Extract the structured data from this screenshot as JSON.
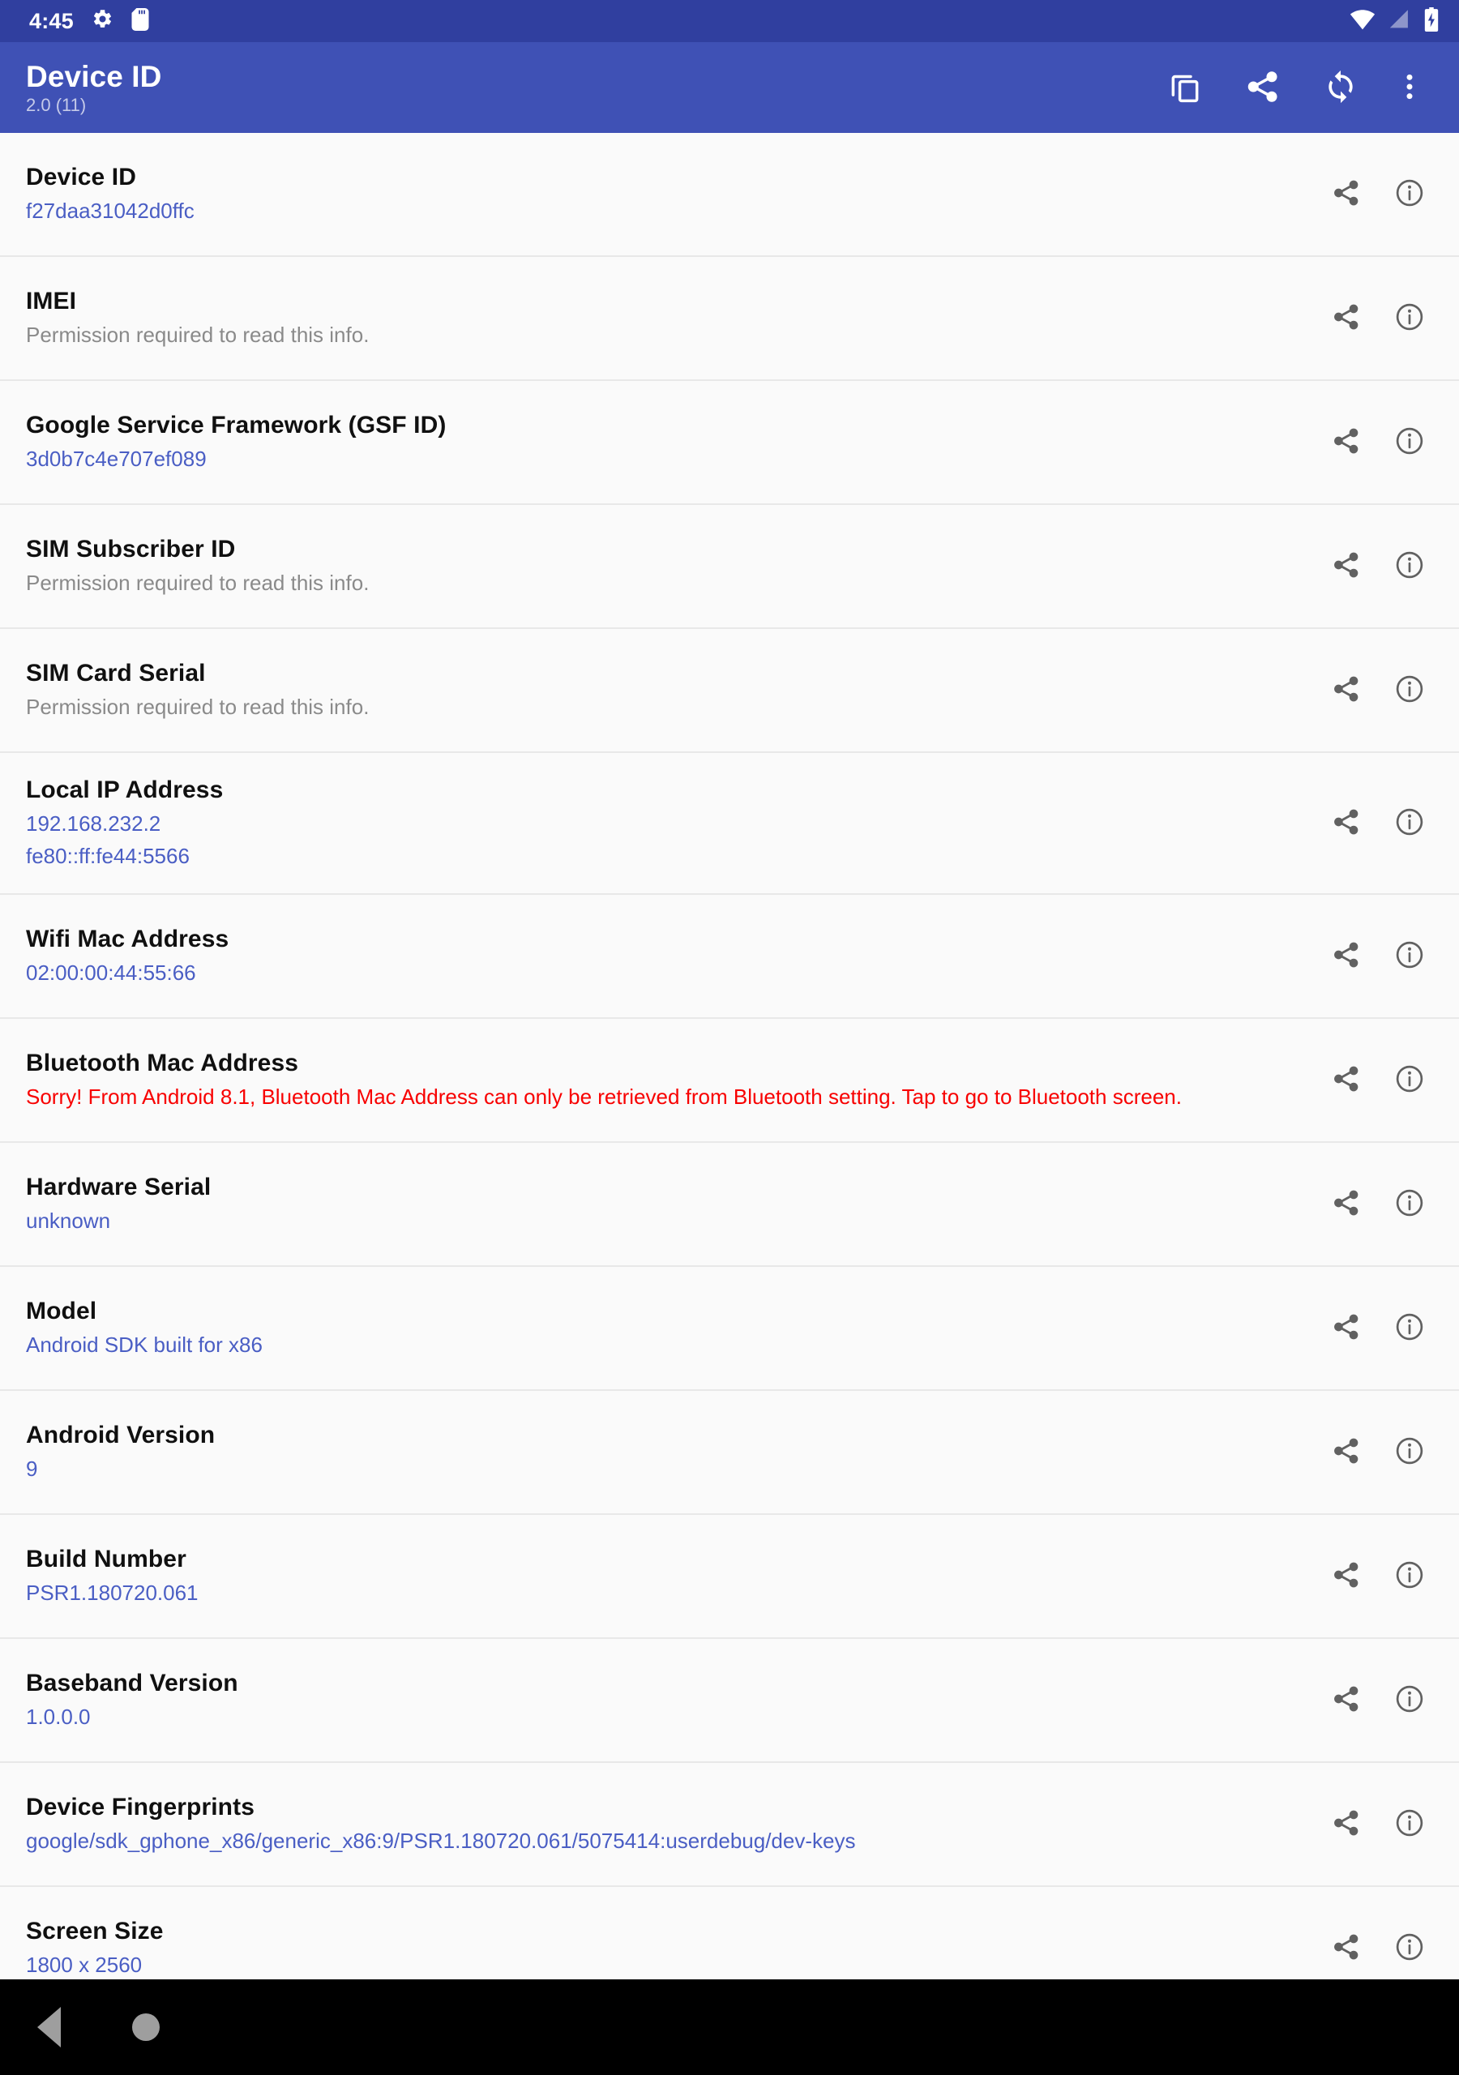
{
  "status_bar": {
    "time": "4:45",
    "icons": [
      "gear-icon",
      "sdcard-icon"
    ],
    "right_icons": [
      "wifi-icon",
      "cell-signal-icon",
      "battery-charging-icon"
    ],
    "background_color": "#303f9f"
  },
  "app_bar": {
    "title": "Device ID",
    "subtitle": "2.0 (11)",
    "background_color": "#3f51b5",
    "actions": [
      {
        "name": "copy-all-button",
        "icon": "copy-icon"
      },
      {
        "name": "share-all-button",
        "icon": "share-icon"
      },
      {
        "name": "refresh-button",
        "icon": "refresh-icon"
      },
      {
        "name": "overflow-menu-button",
        "icon": "more-vert-icon"
      }
    ]
  },
  "colors": {
    "accent": "#3f51b5",
    "value_link": "#4a5ec4",
    "muted": "#8a8a8a",
    "error": "#f80000",
    "row_background": "#fafafa",
    "divider": "#e8e8e8"
  },
  "row_action_labels": {
    "share": "share-icon",
    "info": "info-icon"
  },
  "rows": [
    {
      "title": "Device ID",
      "value": "f27daa31042d0ffc",
      "style": "link"
    },
    {
      "title": "IMEI",
      "value": "Permission required to read this info.",
      "style": "muted"
    },
    {
      "title": "Google Service Framework (GSF ID)",
      "value": "3d0b7c4e707ef089",
      "style": "link"
    },
    {
      "title": "SIM Subscriber ID",
      "value": "Permission required to read this info.",
      "style": "muted"
    },
    {
      "title": "SIM Card Serial",
      "value": "Permission required to read this info.",
      "style": "muted"
    },
    {
      "title": "Local IP Address",
      "value": "192.168.232.2",
      "value2": "fe80::ff:fe44:5566",
      "style": "link"
    },
    {
      "title": "Wifi Mac Address",
      "value": "02:00:00:44:55:66",
      "style": "link"
    },
    {
      "title": "Bluetooth Mac Address",
      "value": "Sorry! From Android 8.1, Bluetooth Mac Address can only be retrieved from Bluetooth setting. Tap to go to Bluetooth screen.",
      "style": "error"
    },
    {
      "title": "Hardware Serial",
      "value": "unknown",
      "style": "link"
    },
    {
      "title": "Model",
      "value": "Android SDK built for x86",
      "style": "link"
    },
    {
      "title": "Android Version",
      "value": "9",
      "style": "link"
    },
    {
      "title": "Build Number",
      "value": "PSR1.180720.061",
      "style": "link"
    },
    {
      "title": "Baseband Version",
      "value": "1.0.0.0",
      "style": "link"
    },
    {
      "title": "Device Fingerprints",
      "value": "google/sdk_gphone_x86/generic_x86:9/PSR1.180720.061/5075414:userdebug/dev-keys",
      "style": "link"
    },
    {
      "title": "Screen Size",
      "value": "1800 x 2560",
      "style": "link"
    }
  ],
  "nav_bar": {
    "buttons": [
      {
        "name": "nav-back-button",
        "icon": "triangle-back-icon"
      },
      {
        "name": "nav-home-button",
        "icon": "circle-home-icon"
      }
    ]
  }
}
